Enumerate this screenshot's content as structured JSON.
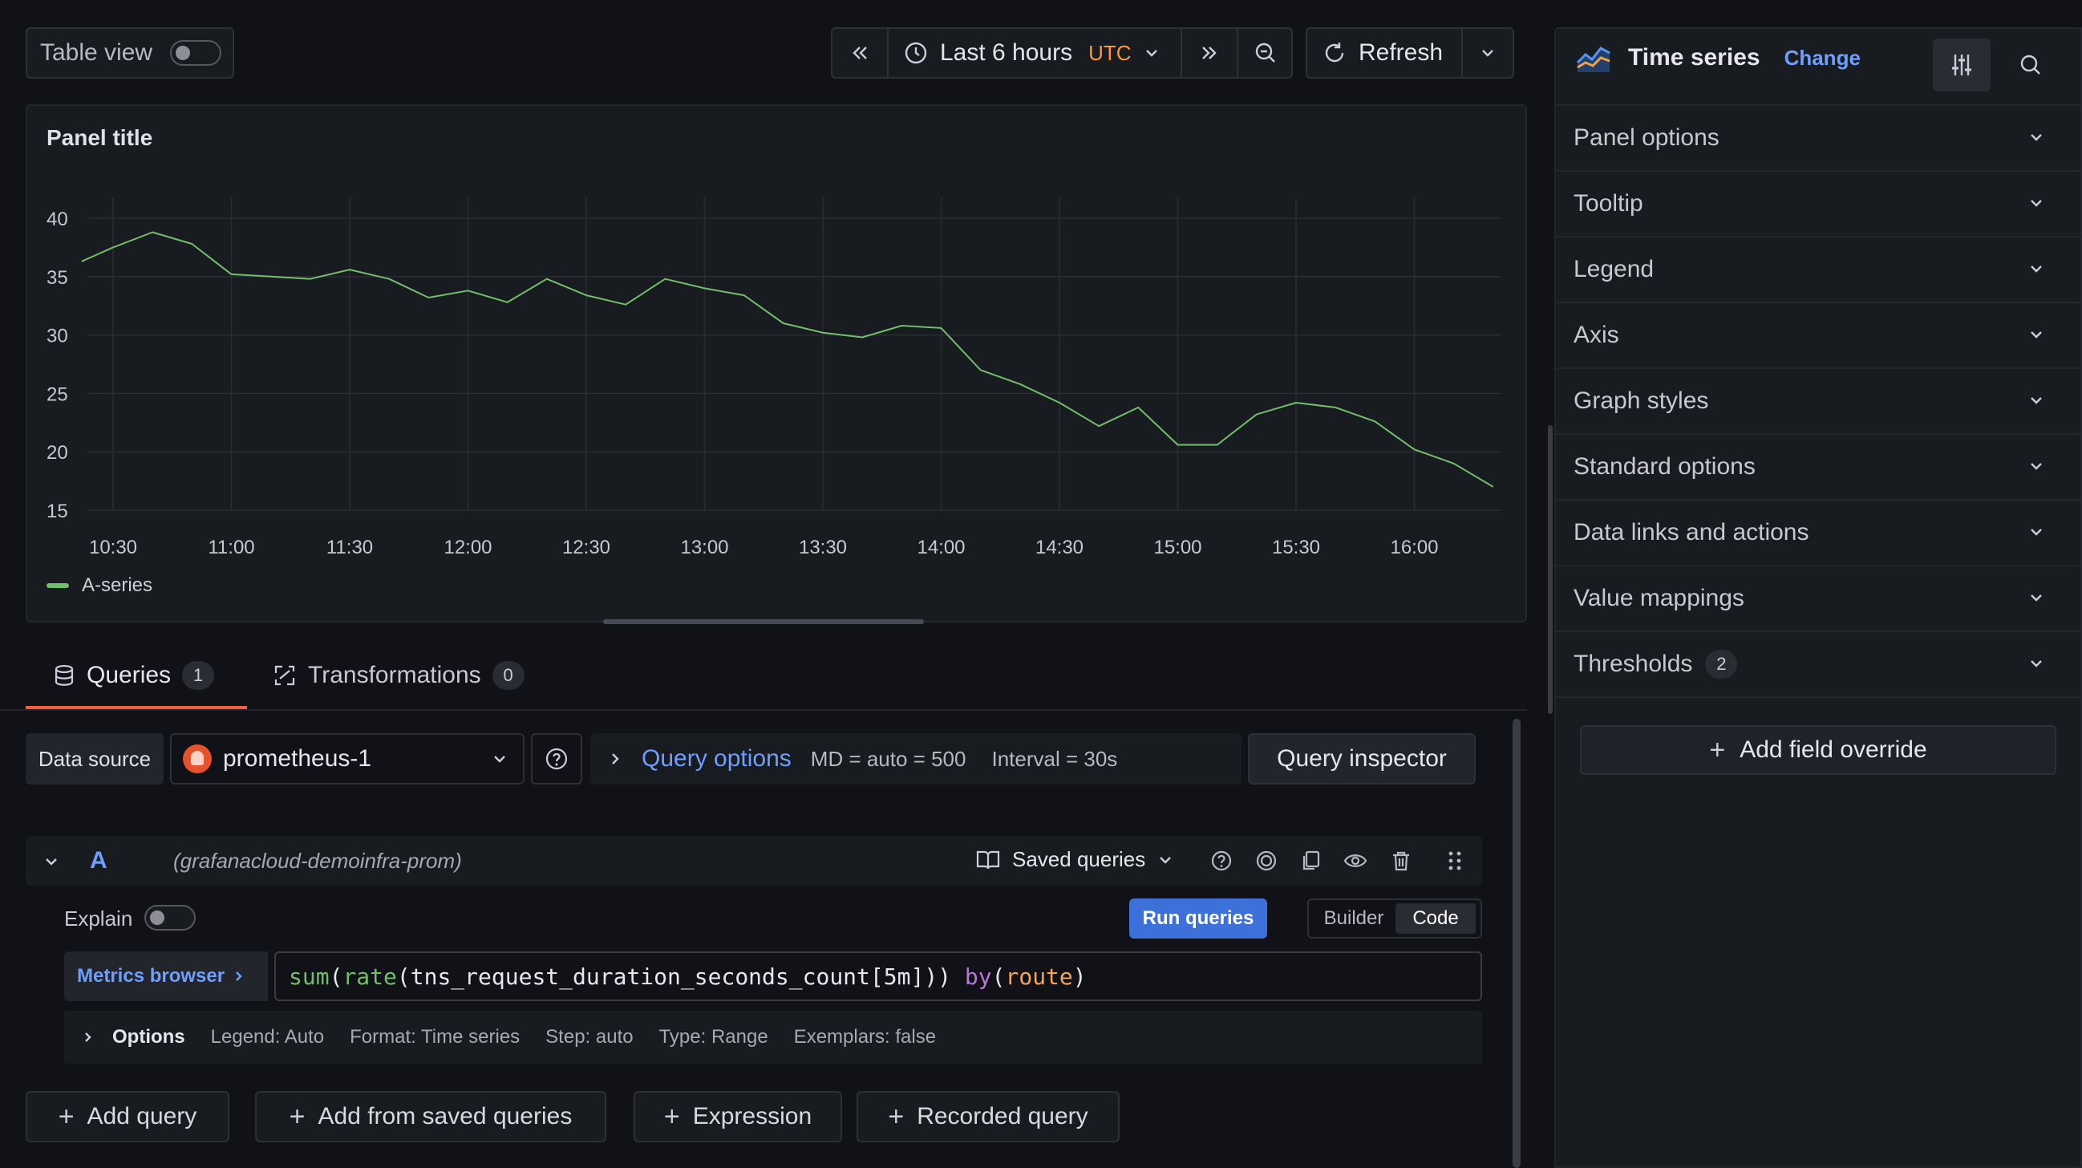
{
  "toolbar": {
    "table_view_label": "Table view",
    "time_range_label": "Last 6 hours",
    "timezone": "UTC",
    "refresh_label": "Refresh"
  },
  "panel": {
    "title": "Panel title",
    "legend": "A-series",
    "series_color": "#73bf69"
  },
  "chart_data": {
    "type": "line",
    "xlabel": "",
    "ylabel": "",
    "ylim": [
      15,
      40
    ],
    "y_ticks": [
      "40",
      "35",
      "30",
      "25",
      "20",
      "15"
    ],
    "x_ticks": [
      "10:30",
      "11:00",
      "11:30",
      "12:00",
      "12:30",
      "13:00",
      "13:30",
      "14:00",
      "14:30",
      "15:00",
      "15:30",
      "16:00"
    ],
    "grid": true,
    "legend_position": "bottom-left",
    "series": [
      {
        "name": "A-series",
        "x": [
          "10:22",
          "10:30",
          "10:40",
          "10:50",
          "11:00",
          "11:10",
          "11:20",
          "11:30",
          "11:40",
          "11:50",
          "12:00",
          "12:10",
          "12:20",
          "12:30",
          "12:40",
          "12:50",
          "13:00",
          "13:10",
          "13:20",
          "13:30",
          "13:40",
          "13:50",
          "14:00",
          "14:10",
          "14:20",
          "14:30",
          "14:40",
          "14:50",
          "15:00",
          "15:10",
          "15:20",
          "15:30",
          "15:40",
          "15:50",
          "16:00",
          "16:10",
          "16:20"
        ],
        "values": [
          36.3,
          37.5,
          38.8,
          37.8,
          35.2,
          35.0,
          34.8,
          35.6,
          34.8,
          33.2,
          33.8,
          32.8,
          34.8,
          33.4,
          32.6,
          34.8,
          34.0,
          33.4,
          31.0,
          30.2,
          29.8,
          30.8,
          30.6,
          27.0,
          25.8,
          24.2,
          22.2,
          23.8,
          20.6,
          20.6,
          23.2,
          24.2,
          23.8,
          22.6,
          20.2,
          19.0,
          17.0
        ]
      }
    ]
  },
  "tabs": {
    "queries_label": "Queries",
    "queries_count": "1",
    "transformations_label": "Transformations",
    "transformations_count": "0"
  },
  "query_editor": {
    "data_source_label": "Data source",
    "data_source_value": "prometheus-1",
    "query_options_label": "Query options",
    "md_text": "MD = auto = 500",
    "interval_text": "Interval = 30s",
    "query_inspector_label": "Query inspector",
    "query_ref": "A",
    "query_datasource": "(grafanacloud-demoinfra-prom)",
    "saved_queries_label": "Saved queries",
    "explain_label": "Explain",
    "run_queries_label": "Run queries",
    "builder_label": "Builder",
    "code_label": "Code",
    "metrics_browser_label": "Metrics browser",
    "query_tokens": {
      "fn1": "sum",
      "p1": "(",
      "fn2": "rate",
      "p2": "(",
      "metric": "tns_request_duration_seconds_count",
      "range": "[5m]",
      "p3": "))",
      "by": "by",
      "p4": "(",
      "label": "route",
      "p5": ")"
    },
    "options_label": "Options",
    "opt_legend": "Legend: Auto",
    "opt_format": "Format: Time series",
    "opt_step": "Step: auto",
    "opt_type": "Type: Range",
    "opt_exemplars": "Exemplars: false"
  },
  "bottom_buttons": {
    "add_query": "Add query",
    "add_from_saved": "Add from saved queries",
    "expression": "Expression",
    "recorded_query": "Recorded query"
  },
  "options_pane": {
    "viz_name": "Time series",
    "change_label": "Change",
    "sections": [
      "Panel options",
      "Tooltip",
      "Legend",
      "Axis",
      "Graph styles",
      "Standard options",
      "Data links and actions",
      "Value mappings",
      "Thresholds"
    ],
    "thresholds_count": "2",
    "add_field_override": "Add field override"
  },
  "colors": {
    "accent_blue": "#6e9fff",
    "run_button": "#3d71d9",
    "timezone_orange": "#ff9830",
    "series_green": "#73bf69"
  }
}
